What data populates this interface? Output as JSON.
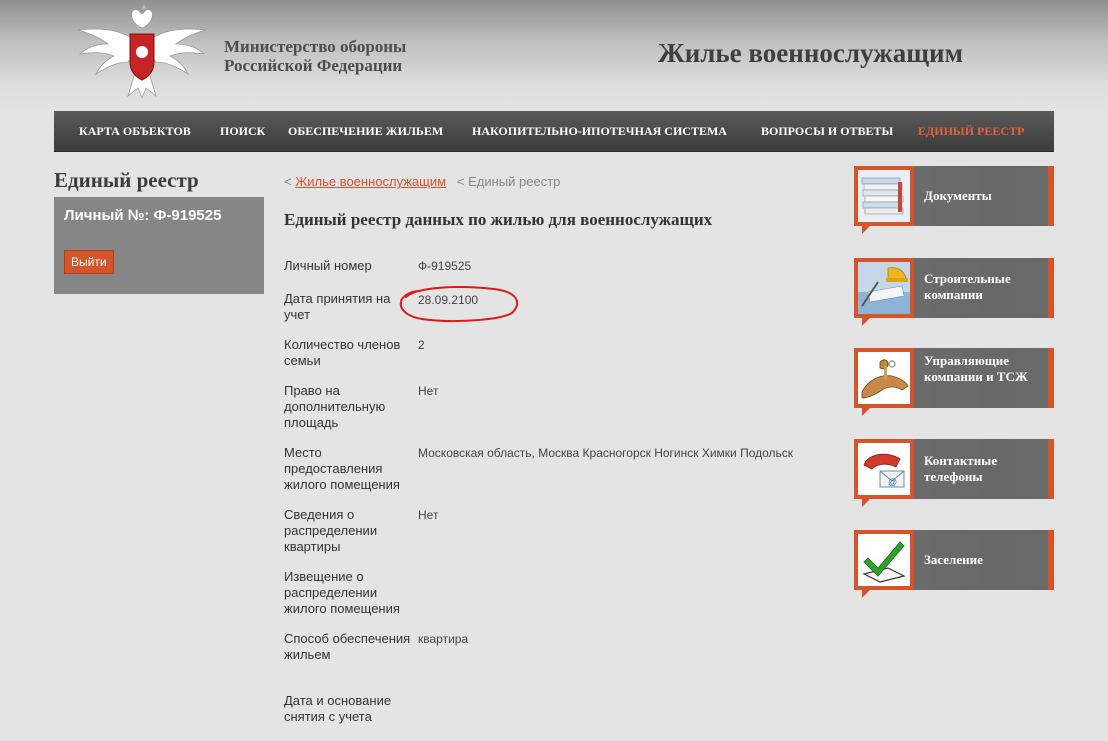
{
  "header": {
    "ministry_line1": "Министерство обороны",
    "ministry_line2": "Российской Федерации",
    "site_title": "Жилье военнослужащим"
  },
  "nav": [
    {
      "label": "КАРТА ОБЪЕКТОВ",
      "active": false
    },
    {
      "label": "ПОИСК",
      "active": false
    },
    {
      "label": "ОБЕСПЕЧЕНИЕ ЖИЛЬЕМ",
      "active": false
    },
    {
      "label": "НАКОПИТЕЛЬНО-ИПОТЕЧНАЯ СИСТЕМА",
      "active": false
    },
    {
      "label": "ВОПРОСЫ И ОТВЕТЫ",
      "active": false
    },
    {
      "label": "ЕДИНЫЙ РЕЕСТР",
      "active": true
    }
  ],
  "left": {
    "title": "Единый реестр",
    "personal_number_label": "Личный №: Ф-919525",
    "logout": "Выйти"
  },
  "breadcrumb": {
    "link": "Жилье военнослужащим",
    "current": "Единый реестр"
  },
  "main": {
    "heading": "Единый реестр данных по жилью для военнослужащих",
    "rows": [
      {
        "label": "Личный номер",
        "value": "Ф-919525"
      },
      {
        "label": "Дата принятия на учет",
        "value": "28.09.2100"
      },
      {
        "label": "Количество членов семьи",
        "value": "2"
      },
      {
        "label": "Право на дополнительную площадь",
        "value": "Нет"
      },
      {
        "label": "Место предоставления жилого помещения",
        "value": "Московская область, Москва Красногорск Ногинск Химки Подольск"
      },
      {
        "label": "Сведения о распределении квартиры",
        "value": "Нет"
      },
      {
        "label": "Извещение о распределении жилого помещения",
        "value": ""
      },
      {
        "label": "Способ обеспечения жильем",
        "value": "квартира"
      },
      {
        "label": "Дата и основание снятия с учета",
        "value": ""
      }
    ]
  },
  "sidebar": [
    {
      "label": "Документы",
      "icon": "documents-icon"
    },
    {
      "label": "Строительные компании",
      "icon": "construction-icon"
    },
    {
      "label": "Управляющие компании и ТСЖ",
      "icon": "keys-hand-icon"
    },
    {
      "label": "Контактные телефоны",
      "icon": "phone-icon"
    },
    {
      "label": "Заселение",
      "icon": "checkmark-icon"
    }
  ],
  "colors": {
    "accent": "#d4542b",
    "nav_bg": "#4a4a4a",
    "panel_bg": "#868686",
    "page_bg": "#e4e4e4",
    "annotation": "#e01818"
  }
}
